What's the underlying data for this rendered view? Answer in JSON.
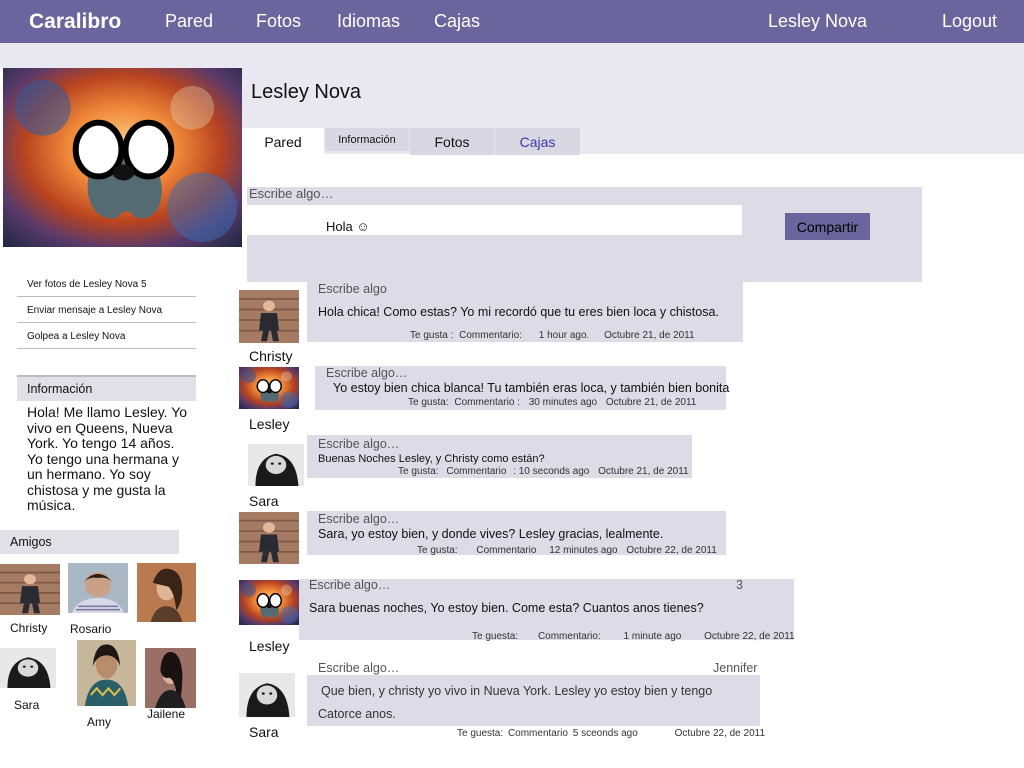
{
  "nav": {
    "brand": "Caralibro",
    "links": [
      "Pared",
      "Fotos",
      "Idiomas",
      "Cajas"
    ],
    "user": "Lesley Nova",
    "logout": "Logout"
  },
  "profile": {
    "name": "Lesley Nova",
    "tabs": [
      "Pared",
      "Información",
      "Fotos",
      "Cajas"
    ]
  },
  "sidebar": {
    "links": [
      "Ver fotos de Lesley Nova 5",
      "Enviar mensaje a Lesley Nova",
      "Golpea a Lesley Nova"
    ],
    "info_title": "Información",
    "info_text": "Hola! Me llamo Lesley. Yo vivo en Queens, Nueva York.  Yo tengo 14 años. Yo tengo una hermana y un hermano. Yo soy chistosa y me gusta la música.",
    "friends_title": "Amigos",
    "friends": [
      "Christy",
      "Rosario",
      "Sara",
      "Amy",
      "Jailene"
    ]
  },
  "composer": {
    "label": "Escribe algo…",
    "value": "Hola ☺",
    "button": "Compartir"
  },
  "posts": [
    {
      "author": "Christy",
      "header": "Escribe algo",
      "text": "Hola chica! Como estas? Yo mi recordó que tu eres bien loca y chistosa.",
      "like": "Te gusta :",
      "comment": "Commentario:",
      "time": "1 hour ago.",
      "date": "Octubre 21, de 2011"
    },
    {
      "author": "Lesley",
      "header": "Escribe algo…",
      "text": "Yo estoy bien chica blanca! Tu también eras loca, y también bien bonita",
      "like": "Te gusta:",
      "comment": "Commentario :",
      "time": "30 minutes ago",
      "date": "Octubre 21, de 2011"
    },
    {
      "author": "Sara",
      "header": "Escribe algo…",
      "text": "Buenas Noches  Lesley, y Christy como están?",
      "like": "Te gusta:",
      "comment": "Commentario",
      "time": ": 10 seconds ago",
      "date": "Octubre 21,  de 2011"
    },
    {
      "author": "",
      "header": "Escribe algo…",
      "text": "Sara, yo estoy bien, y donde vives? Lesley gracias, lealmente.",
      "like": "Te gusta:",
      "comment": "Commentario",
      "time": "12  minutes ago",
      "date": "Octubre 22, de 2011"
    },
    {
      "author": "Lesley",
      "header": "Escribe algo…",
      "extra": "3",
      "text": "Sara buenas noches, Yo estoy bien. Come esta? Cuantos anos tienes?",
      "like": "Te guesta:",
      "comment": "Commentario:",
      "time": "1 minute ago",
      "date": "Octubre 22, de 2011"
    },
    {
      "author": "Sara",
      "header": "Escribe algo…",
      "extra": "Jennifer",
      "text1": "Que bien, y christy yo vivo in Nueva York. Lesley yo estoy bien y tengo",
      "text2": "Catorce anos.",
      "like": "Te guesta:",
      "comment": "Commentario",
      "time": "5 sceonds ago",
      "date": "Octubre 22, de 2011"
    }
  ]
}
